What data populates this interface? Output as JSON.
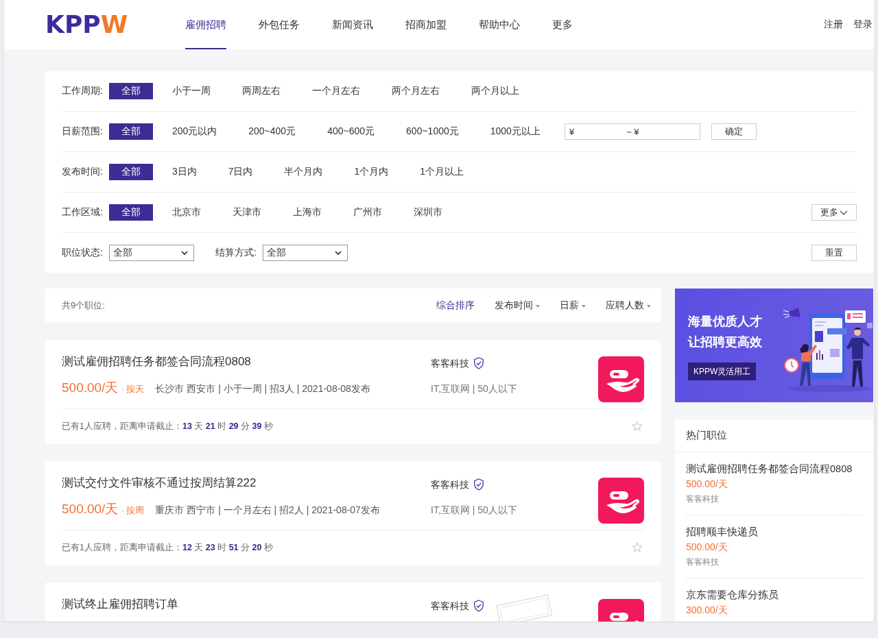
{
  "header": {
    "logo": {
      "main": "KPP",
      "accent": "W"
    },
    "nav": [
      {
        "label": "雇佣招聘",
        "selected": true
      },
      {
        "label": "外包任务",
        "selected": false
      },
      {
        "label": "新闻资讯",
        "selected": false
      },
      {
        "label": "招商加盟",
        "selected": false
      },
      {
        "label": "帮助中心",
        "selected": false
      },
      {
        "label": "更多",
        "selected": false
      }
    ],
    "auth_links": [
      "注册",
      "登录"
    ]
  },
  "filters": {
    "rows": [
      {
        "label": "工作周期:",
        "options": [
          {
            "label": "全部",
            "selected": true
          },
          {
            "label": "小于一周",
            "selected": false
          },
          {
            "label": "两周左右",
            "selected": false
          },
          {
            "label": "一个月左右",
            "selected": false
          },
          {
            "label": "两个月左右",
            "selected": false
          },
          {
            "label": "两个月以上",
            "selected": false
          }
        ]
      },
      {
        "label": "日薪范围:",
        "options": [
          {
            "label": "全部",
            "selected": true
          },
          {
            "label": "200元以内",
            "selected": false
          },
          {
            "label": "200~400元",
            "selected": false
          },
          {
            "label": "400~600元",
            "selected": false
          },
          {
            "label": "600~1000元",
            "selected": false
          },
          {
            "label": "1000元以上",
            "selected": false
          }
        ],
        "range": {
          "min_prefix": "¥",
          "max_prefix": "~ ¥"
        },
        "confirm_button": "确定"
      },
      {
        "label": "发布时间:",
        "options": [
          {
            "label": "全部",
            "selected": true
          },
          {
            "label": "3日内",
            "selected": false
          },
          {
            "label": "7日内",
            "selected": false
          },
          {
            "label": "半个月内",
            "selected": false
          },
          {
            "label": "1个月内",
            "selected": false
          },
          {
            "label": "1个月以上",
            "selected": false
          }
        ]
      },
      {
        "label": "工作区域:",
        "options": [
          {
            "label": "全部",
            "selected": true
          },
          {
            "label": "北京市",
            "selected": false
          },
          {
            "label": "天津市",
            "selected": false
          },
          {
            "label": "上海市",
            "selected": false
          },
          {
            "label": "广州市",
            "selected": false
          },
          {
            "label": "深圳市",
            "selected": false
          }
        ],
        "more_button": "更多"
      }
    ],
    "selects": [
      {
        "label": "职位状态:",
        "value": "全部"
      },
      {
        "label": "结算方式:",
        "value": "全部"
      }
    ],
    "reset_button": "重置"
  },
  "job_list": {
    "count": "共9个职位:",
    "sort_options": [
      {
        "label": "综合排序",
        "selected": true,
        "kind": "plain"
      },
      {
        "label": "发布时间",
        "selected": false,
        "kind": "dropdown"
      },
      {
        "label": "日薪",
        "selected": false,
        "kind": "dropdown"
      },
      {
        "label": "应聘人数",
        "selected": false,
        "kind": "dropdown"
      }
    ],
    "jobs": [
      {
        "title": "测试雇佣招聘任务都签合同流程0808",
        "salary": "500.00/天",
        "settlement": "· 按天",
        "meta": "长沙市 西安市 | 小于一周 | 招3人 | 2021-08-08发布",
        "company": "客客科技",
        "verified": true,
        "industry": "IT,互联网 | 50人以下",
        "deadline": "已有1人应聘，距离申请截止：**13** 天 **21** 时 **29** 分 **39** 秒",
        "favorited": false,
        "stamped": false
      },
      {
        "title": "测试交付文件审核不通过按周结算222",
        "salary": "500.00/天",
        "settlement": "· 按周",
        "meta": "重庆市 西宁市 | 一个月左右 | 招2人 | 2021-08-07发布",
        "company": "客客科技",
        "verified": true,
        "industry": "IT,互联网 | 50人以下",
        "deadline": "已有1人应聘，距离申请截止：**12** 天 **23** 时 **51** 分 **20** 秒",
        "favorited": false,
        "stamped": false
      },
      {
        "title": "测试终止雇佣招聘订单",
        "company": "客客科技",
        "verified": true,
        "stamped": true
      }
    ]
  },
  "sidebar": {
    "banner": {
      "lines": [
        "海量优质人才",
        "让招聘更高效"
      ],
      "button": "KPPW灵活用工"
    },
    "hot_jobs": {
      "title": "热门职位",
      "items": [
        {
          "title": "测试雇佣招聘任务都签合同流程0808",
          "salary": "500.00/天",
          "company": "客客科技"
        },
        {
          "title": "招聘顺丰快递员",
          "salary": "500.00/天",
          "company": "客客科技"
        },
        {
          "title": "京东需要仓库分拣员",
          "salary": "300.00/天"
        }
      ]
    }
  }
}
